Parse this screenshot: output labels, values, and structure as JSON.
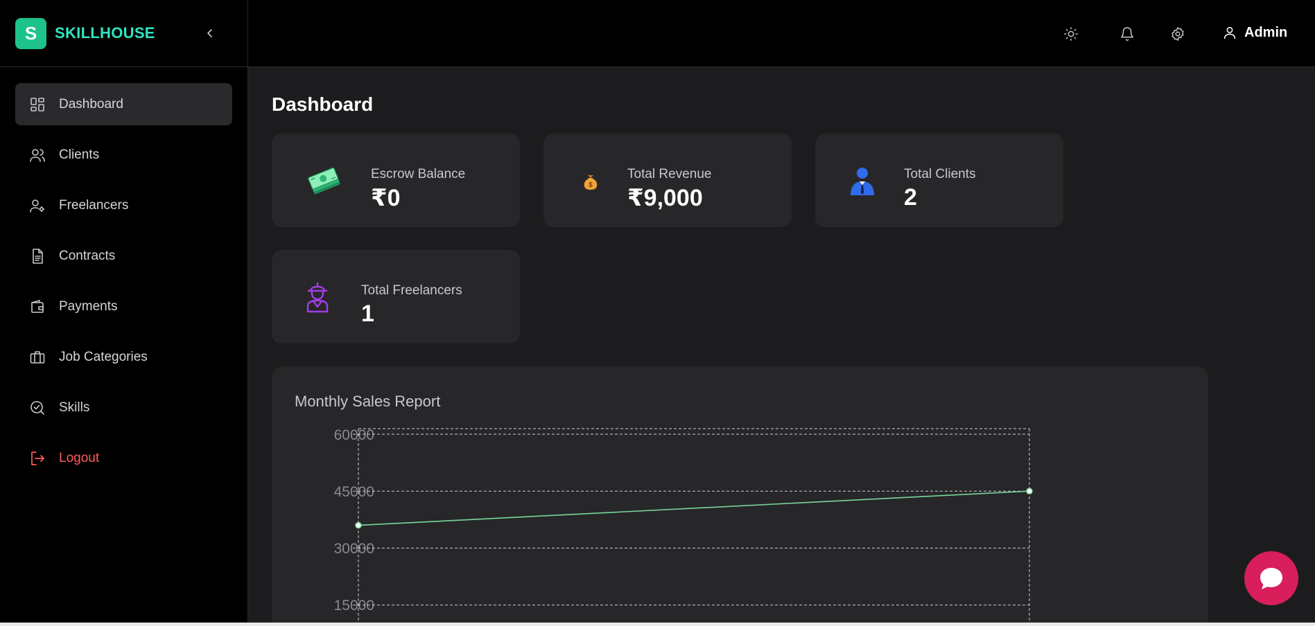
{
  "brand": {
    "logo_letter": "S",
    "name": "SKILLHOUSE"
  },
  "sidebar": {
    "items": [
      {
        "label": "Dashboard",
        "icon": "dashboard-icon",
        "active": true
      },
      {
        "label": "Clients",
        "icon": "users-icon"
      },
      {
        "label": "Freelancers",
        "icon": "user-gear-icon"
      },
      {
        "label": "Contracts",
        "icon": "document-icon"
      },
      {
        "label": "Payments",
        "icon": "wallet-icon"
      },
      {
        "label": "Job Categories",
        "icon": "briefcase-icon"
      },
      {
        "label": "Skills",
        "icon": "badge-check-icon"
      },
      {
        "label": "Logout",
        "icon": "logout-icon"
      }
    ]
  },
  "header": {
    "user_name": "Admin"
  },
  "page": {
    "title": "Dashboard"
  },
  "stats": [
    {
      "label": "Escrow Balance",
      "value": "₹0",
      "icon": "money-stack-icon"
    },
    {
      "label": "Total Revenue",
      "value": "₹9,000",
      "icon": "money-bag-icon"
    },
    {
      "label": "Total Clients",
      "value": "2",
      "icon": "client-person-icon"
    },
    {
      "label": "Total Freelancers",
      "value": "1",
      "icon": "freelancer-icon"
    }
  ],
  "colors": {
    "accent": "#1ec28b",
    "brand_text": "#2ee6c3",
    "logout": "#ff5c5c",
    "line": "#7ad79a",
    "chat": "#d81e5b"
  },
  "chart_data": {
    "type": "line",
    "title": "Monthly Sales Report",
    "y_ticks": [
      "60000",
      "45000",
      "30000",
      "15000"
    ],
    "ylim": [
      0,
      60000
    ],
    "grid": true,
    "series": [
      {
        "values": [
          36000,
          45000
        ]
      }
    ]
  }
}
